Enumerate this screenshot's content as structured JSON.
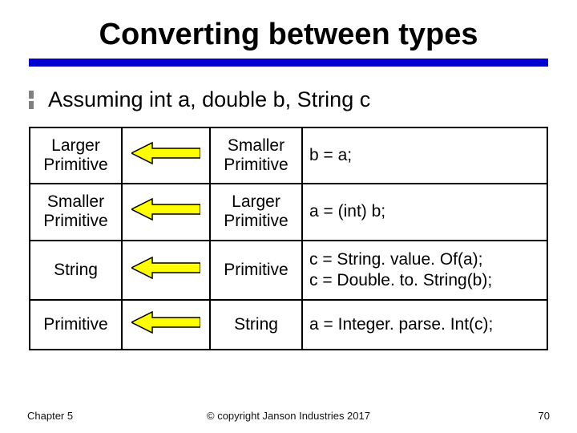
{
  "title": "Converting between types",
  "bullet": "Assuming int a, double b, String c",
  "table": {
    "rows": [
      {
        "left": "Larger Primitive",
        "mid": "Smaller Primitive",
        "code": "b = a;"
      },
      {
        "left": "Smaller Primitive",
        "mid": "Larger Primitive",
        "code": "a = (int)  b;"
      },
      {
        "left": "String",
        "mid": "Primitive",
        "code": "c = String. value. Of(a);\nc = Double. to. String(b);"
      },
      {
        "left": "Primitive",
        "mid": "String",
        "code": "a = Integer. parse. Int(c);"
      }
    ]
  },
  "footer": {
    "left": "Chapter 5",
    "center": "© copyright Janson Industries 2017",
    "right": "70"
  },
  "icons": {
    "arrow": "left-arrow-icon"
  }
}
